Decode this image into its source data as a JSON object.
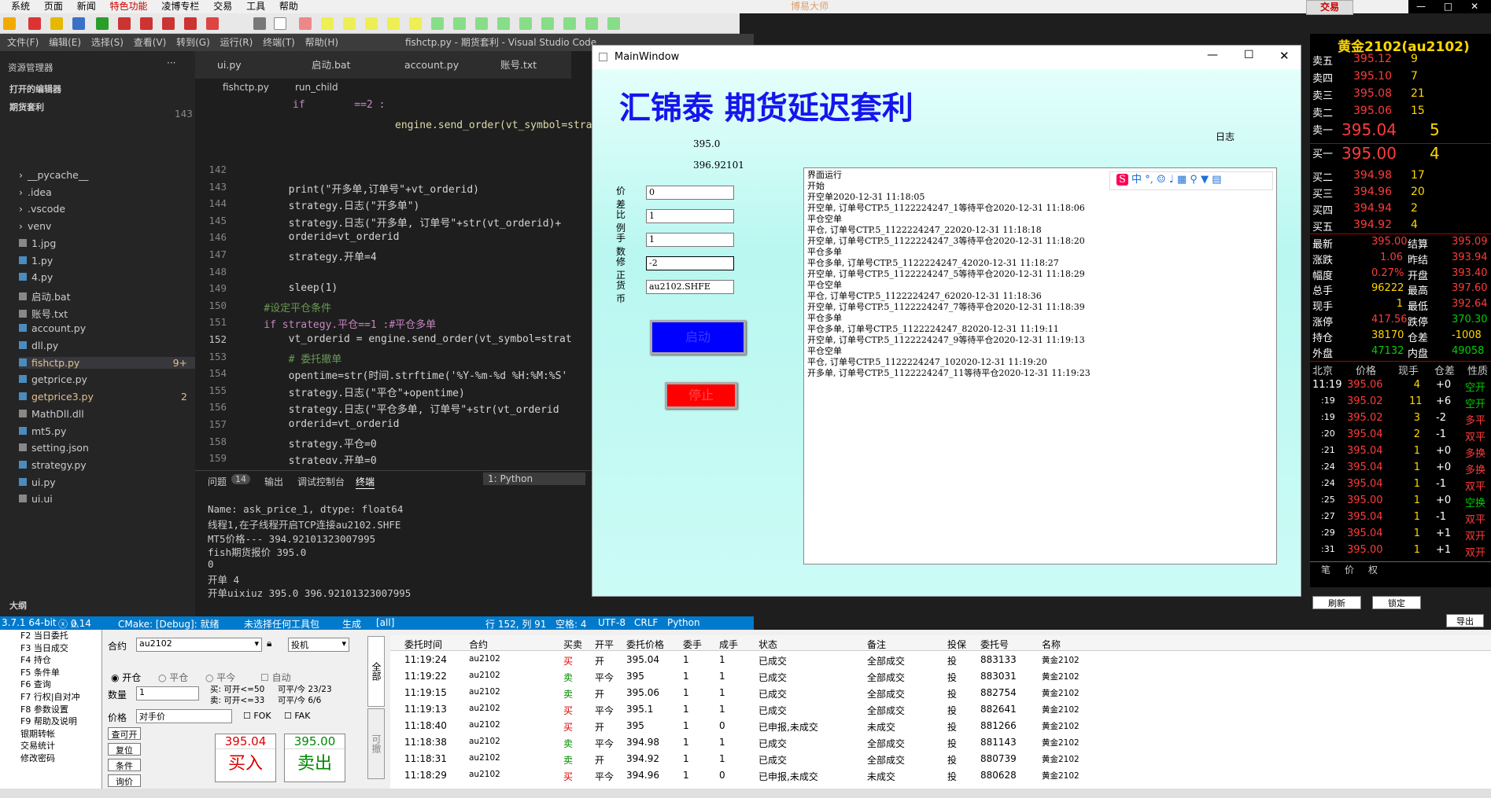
{
  "menu": [
    "系统",
    "页面",
    "新闻",
    "特色功能",
    "凌博专栏",
    "交易",
    "工具",
    "帮助"
  ],
  "app_brand": "博易大师",
  "trade_btn": "交易",
  "vscode": {
    "title": "fishctp.py - 期货套利 - Visual Studio Code",
    "menus": [
      "文件(F)",
      "编辑(E)",
      "选择(S)",
      "查看(V)",
      "转到(G)",
      "运行(R)",
      "终端(T)",
      "帮助(H)"
    ],
    "explorer_header": "资源管理器",
    "open_editors": "打开的编辑器",
    "folder": "期货套利",
    "files": [
      {
        "name": "__pycache__",
        "folder": true
      },
      {
        "name": ".idea",
        "folder": true
      },
      {
        "name": ".vscode",
        "folder": true
      },
      {
        "name": "venv",
        "folder": true
      },
      {
        "name": "1.jpg"
      },
      {
        "name": "1.py"
      },
      {
        "name": "4.py"
      },
      {
        "name": "启动.bat"
      },
      {
        "name": "账号.txt"
      },
      {
        "name": "account.py"
      },
      {
        "name": "dll.py"
      },
      {
        "name": "fishctp.py",
        "badge": "9+",
        "active": true,
        "color": "#e2c08d"
      },
      {
        "name": "getprice.py"
      },
      {
        "name": "getprice3.py",
        "badge": "2",
        "color": "#e2c08d"
      },
      {
        "name": "MathDll.dll"
      },
      {
        "name": "mt5.py"
      },
      {
        "name": "setting.json"
      },
      {
        "name": "strategy.py"
      },
      {
        "name": "ui.py"
      },
      {
        "name": "ui.ui"
      }
    ],
    "outline": "大纲",
    "tabs": [
      "ui.py",
      "启动.bat",
      "account.py",
      "账号.txt"
    ],
    "breadcrumb": [
      "fishctp.py",
      "run_child"
    ],
    "line_count_hint": "143",
    "code_top": [
      "if        ==2 :",
      "engine.send_order(vt_symbol=strat"
    ],
    "code": [
      {
        "n": "142",
        "t": ""
      },
      {
        "n": "143",
        "t": "        print(\"开多单,订单号\"+vt_orderid)"
      },
      {
        "n": "144",
        "t": "        strategy.日志(\"开多单\")"
      },
      {
        "n": "145",
        "t": "        strategy.日志(\"开多单, 订单号\"+str(vt_orderid)+"
      },
      {
        "n": "146",
        "t": "        orderid=vt_orderid"
      },
      {
        "n": "147",
        "t": "        strategy.开单=4"
      },
      {
        "n": "148",
        "t": ""
      },
      {
        "n": "149",
        "t": "        sleep(1)"
      },
      {
        "n": "150",
        "t": "    #设定平仓条件"
      },
      {
        "n": "151",
        "t": "    if strategy.平仓==1 :#平仓多单"
      },
      {
        "n": "152",
        "t": "        vt_orderid = engine.send_order(vt_symbol=strat"
      },
      {
        "n": "153",
        "t": "        # 委托撤单"
      },
      {
        "n": "154",
        "t": "        opentime=str(时间.strftime('%Y-%m-%d %H:%M:%S'"
      },
      {
        "n": "155",
        "t": "        strategy.日志(\"平仓\"+opentime)"
      },
      {
        "n": "156",
        "t": "        strategy.日志(\"平仓多单, 订单号\"+str(vt_orderid"
      },
      {
        "n": "157",
        "t": "        orderid=vt_orderid"
      },
      {
        "n": "158",
        "t": "        strategy.平仓=0"
      },
      {
        "n": "159",
        "t": "        strategy.开单=0"
      },
      {
        "n": "160",
        "t": "    #设定平仓条件"
      },
      {
        "n": "161",
        "t": "    if strategy.平仓==2 :#平仓空单"
      },
      {
        "n": "162",
        "t": "        vt_orderid = engine.send_order(vt_symbol=strat"
      }
    ],
    "panel_tabs": [
      "问题",
      "输出",
      "调试控制台",
      "终端"
    ],
    "problems_count": "14",
    "terminal_select": "1: Python",
    "terminal": [
      "Name: ask_price_1, dtype: float64",
      "线程1,在子线程开启TCP连接au2102.SHFE",
      "MT5价格--- 394.92101323007995",
      "fish期货报价 395.0",
      "0",
      "开单 4",
      "开单uixiuz 395.0 396.92101323007995"
    ],
    "status": {
      "arch": "3.7.1 64-bit",
      "errors": "0",
      "warnings": "14",
      "cmake": "CMake: [Debug]: 就绪",
      "kit": "未选择任何工具包",
      "build": "生成",
      "all": "[all]",
      "pos": "行 152, 列 91",
      "spaces": "空格: 4",
      "enc": "UTF-8",
      "eol": "CRLF",
      "lang": "Python"
    }
  },
  "mainwindow": {
    "title": "MainWindow",
    "heading": "汇锦泰 期货延迟套利",
    "price1": "395.0",
    "price2": "396.92101",
    "log_label": "日志",
    "fields": [
      {
        "label": "价差",
        "value": "0"
      },
      {
        "label": "比例",
        "value": "1"
      },
      {
        "label": "手数",
        "value": "1"
      },
      {
        "label": "修正",
        "value": "-2"
      },
      {
        "label": "货币",
        "value": "au2102.SHFE"
      }
    ],
    "start_btn": "启动",
    "stop_btn": "停止",
    "log": [
      "界面运行",
      "开始",
      "开空单2020-12-31 11:18:05",
      "开空单, 订单号CTP.5_1122224247_1等待平仓2020-12-31 11:18:06",
      "平仓空单",
      "平仓, 订单号CTP.5_1122224247_22020-12-31 11:18:18",
      "开空单, 订单号CTP.5_1122224247_3等待平仓2020-12-31 11:18:20",
      "平仓多单",
      "平仓多单, 订单号CTP.5_1122224247_42020-12-31 11:18:27",
      "开空单, 订单号CTP.5_1122224247_5等待平仓2020-12-31 11:18:29",
      "平仓空单",
      "平仓, 订单号CTP.5_1122224247_62020-12-31 11:18:36",
      "开空单, 订单号CTP.5_1122224247_7等待平仓2020-12-31 11:18:39",
      "平仓多单",
      "平仓多单, 订单号CTP.5_1122224247_82020-12-31 11:19:11",
      "开空单, 订单号CTP.5_1122224247_9等待平仓2020-12-31 11:19:13",
      "平仓空单",
      "平仓, 订单号CTP.5_1122224247_102020-12-31 11:19:20",
      "开多单, 订单号CTP.5_1122224247_11等待平仓2020-12-31 11:19:23"
    ],
    "ime": "中"
  },
  "quote": {
    "title": "黄金2102(au2102)",
    "asks": [
      {
        "l": "卖五",
        "p": "395.12",
        "v": "9"
      },
      {
        "l": "卖四",
        "p": "395.10",
        "v": "7"
      },
      {
        "l": "卖三",
        "p": "395.08",
        "v": "21"
      },
      {
        "l": "卖二",
        "p": "395.06",
        "v": "15"
      },
      {
        "l": "卖一",
        "p": "395.04",
        "v": "5"
      }
    ],
    "bids": [
      {
        "l": "买一",
        "p": "395.00",
        "v": "4"
      },
      {
        "l": "买二",
        "p": "394.98",
        "v": "17"
      },
      {
        "l": "买三",
        "p": "394.96",
        "v": "20"
      },
      {
        "l": "买四",
        "p": "394.94",
        "v": "2"
      },
      {
        "l": "买五",
        "p": "394.92",
        "v": "4"
      }
    ],
    "stats": [
      {
        "a": "最新",
        "b": "395.00",
        "c": "结算",
        "d": "395.09"
      },
      {
        "a": "涨跌",
        "b": "1.06",
        "c": "昨结",
        "d": "393.94"
      },
      {
        "a": "幅度",
        "b": "0.27%",
        "c": "开盘",
        "d": "393.40"
      },
      {
        "a": "总手",
        "b": "96222",
        "c": "最高",
        "d": "397.60"
      },
      {
        "a": "现手",
        "b": "1",
        "c": "最低",
        "d": "392.64"
      },
      {
        "a": "涨停",
        "b": "417.56",
        "c": "跌停",
        "d": "370.30"
      },
      {
        "a": "持仓",
        "b": "38170",
        "c": "仓差",
        "d": "-1008"
      },
      {
        "a": "外盘",
        "b": "47132",
        "c": "内盘",
        "d": "49058"
      }
    ],
    "tick_header": [
      "北京",
      "价格",
      "现手",
      "仓差",
      "性质"
    ],
    "ticks": [
      {
        "t": "11:19",
        "p": "395.06",
        "v": "4",
        "d": "+0",
        "k": "空开"
      },
      {
        "t": ":19",
        "p": "395.02",
        "v": "11",
        "d": "+6",
        "k": "空开"
      },
      {
        "t": ":19",
        "p": "395.02",
        "v": "3",
        "d": "-2",
        "k": "多平"
      },
      {
        "t": ":20",
        "p": "395.04",
        "v": "2",
        "d": "-1",
        "k": "双平"
      },
      {
        "t": ":21",
        "p": "395.04",
        "v": "1",
        "d": "+0",
        "k": "多换"
      },
      {
        "t": ":24",
        "p": "395.04",
        "v": "1",
        "d": "+0",
        "k": "多换"
      },
      {
        "t": ":24",
        "p": "395.04",
        "v": "1",
        "d": "-1",
        "k": "双平"
      },
      {
        "t": ":25",
        "p": "395.00",
        "v": "1",
        "d": "+0",
        "k": "空换"
      },
      {
        "t": ":27",
        "p": "395.04",
        "v": "1",
        "d": "-1",
        "k": "双平"
      },
      {
        "t": ":29",
        "p": "395.04",
        "v": "1",
        "d": "+1",
        "k": "双开"
      },
      {
        "t": ":31",
        "p": "395.00",
        "v": "1",
        "d": "+1",
        "k": "双开"
      }
    ],
    "bottom_tabs": [
      "笔",
      "价",
      "权"
    ]
  },
  "trade": {
    "side_menu": [
      "F2 当日委托",
      "F3 当日成交",
      "F4 持仓",
      "F5 条件单",
      "F6 查询",
      "F7 行权|自对冲",
      "F8 参数设置",
      "F9 帮助及说明",
      "银期转帐",
      "交易统计",
      "修改密码"
    ],
    "contract_label": "合约",
    "contract": "au2102",
    "hedge": "投机",
    "radio": [
      "开仓",
      "平仓",
      "平今"
    ],
    "auto": "自动",
    "qty_label": "数量",
    "qty": "1",
    "buy_limit": "买: 可开<=50",
    "sell_limit": "卖: 可开<=33",
    "buy_close": "可平/今 23/23",
    "sell_close": "可平/今 6/6",
    "price_label": "价格",
    "price_mode": "对手价",
    "fok": "FOK",
    "fak": "FAK",
    "btns": [
      "查可开",
      "复位",
      "条件",
      "询价"
    ],
    "ask_price": "395.04",
    "buy_label": "买入",
    "bid_price": "395.00",
    "sell_label": "卖出",
    "vtabs": [
      "全部",
      "可撤"
    ],
    "refresh": "刷新",
    "lock": "锁定",
    "export": "导出",
    "columns": [
      "委托时间",
      "合约",
      "买卖",
      "开平",
      "委托价格",
      "委手",
      "成手",
      "状态",
      "备注",
      "投保",
      "委托号",
      "名称"
    ],
    "rows": [
      [
        "11:19:24",
        "au2102",
        "买",
        "开",
        "395.04",
        "1",
        "1",
        "已成交",
        "全部成交",
        "投",
        "883133",
        "黄金2102"
      ],
      [
        "11:19:22",
        "au2102",
        "卖",
        "平今",
        "395",
        "1",
        "1",
        "已成交",
        "全部成交",
        "投",
        "883031",
        "黄金2102"
      ],
      [
        "11:19:15",
        "au2102",
        "卖",
        "开",
        "395.06",
        "1",
        "1",
        "已成交",
        "全部成交",
        "投",
        "882754",
        "黄金2102"
      ],
      [
        "11:19:13",
        "au2102",
        "买",
        "平今",
        "395.1",
        "1",
        "1",
        "已成交",
        "全部成交",
        "投",
        "882641",
        "黄金2102"
      ],
      [
        "11:18:40",
        "au2102",
        "买",
        "开",
        "395",
        "1",
        "0",
        "已申报,未成交",
        "未成交",
        "投",
        "881266",
        "黄金2102"
      ],
      [
        "11:18:38",
        "au2102",
        "卖",
        "平今",
        "394.98",
        "1",
        "1",
        "已成交",
        "全部成交",
        "投",
        "881143",
        "黄金2102"
      ],
      [
        "11:18:31",
        "au2102",
        "卖",
        "开",
        "394.92",
        "1",
        "1",
        "已成交",
        "全部成交",
        "投",
        "880739",
        "黄金2102"
      ],
      [
        "11:18:29",
        "au2102",
        "买",
        "平今",
        "394.96",
        "1",
        "0",
        "已申报,未成交",
        "未成交",
        "投",
        "880628",
        "黄金2102"
      ]
    ]
  },
  "colors": {
    "vs_blue": "#007acc",
    "up": "#ff3b3b",
    "down": "#00d000",
    "yellow": "#ffd700"
  }
}
